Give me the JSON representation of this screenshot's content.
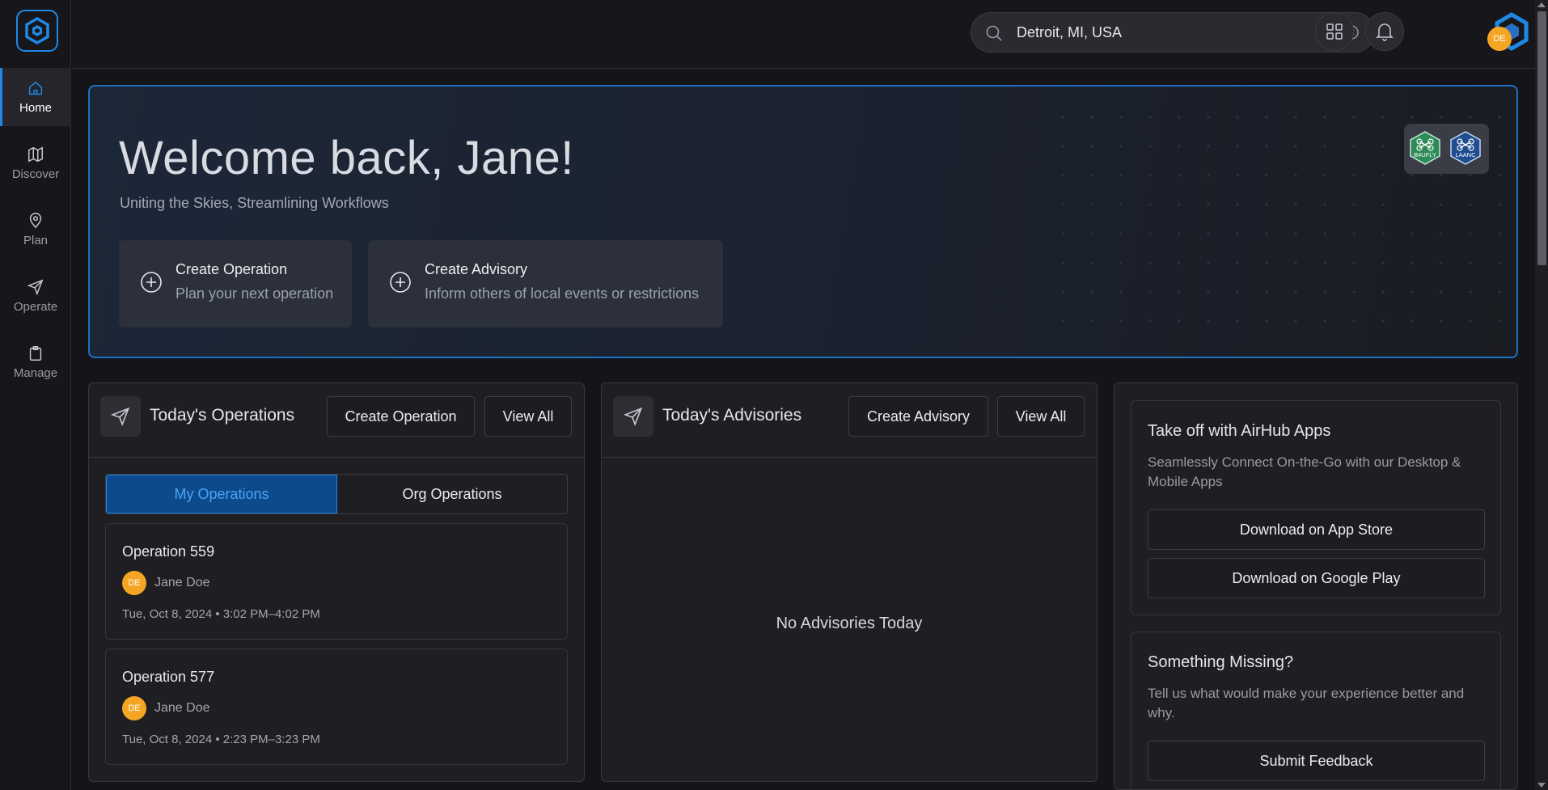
{
  "colors": {
    "accent": "#1e88e5",
    "avatar": "#f5a524",
    "background": "#151519"
  },
  "sidebar": {
    "items": [
      {
        "label": "Home",
        "icon": "home-icon",
        "active": true
      },
      {
        "label": "Discover",
        "icon": "map-icon"
      },
      {
        "label": "Plan",
        "icon": "map-pin-icon"
      },
      {
        "label": "Operate",
        "icon": "send-icon"
      },
      {
        "label": "Manage",
        "icon": "clipboard-icon"
      }
    ]
  },
  "header": {
    "search_value": "Detroit, MI, USA",
    "avatar_initials": "DE",
    "add_label": "+"
  },
  "hero": {
    "title": "Welcome back, Jane!",
    "subtitle": "Uniting the Skies, Streamlining Workflows",
    "cards": [
      {
        "title": "Create Operation",
        "subtitle": "Plan your next operation"
      },
      {
        "title": "Create Advisory",
        "subtitle": "Inform others of local events or restrictions"
      }
    ],
    "partners": [
      {
        "label": "B4UFLY",
        "color": "#2e8b57"
      },
      {
        "label": "LAANC",
        "color": "#1f4d8f"
      }
    ]
  },
  "operations": {
    "title": "Today's Operations",
    "create_label": "Create Operation",
    "view_all_label": "View All",
    "tabs": [
      "My Operations",
      "Org Operations"
    ],
    "items": [
      {
        "name": "Operation 559",
        "initials": "DE",
        "user": "Jane Doe",
        "time": "Tue, Oct 8, 2024 • 3:02 PM–4:02 PM"
      },
      {
        "name": "Operation 577",
        "initials": "DE",
        "user": "Jane Doe",
        "time": "Tue, Oct 8, 2024 • 2:23 PM–3:23 PM"
      }
    ]
  },
  "advisories": {
    "title": "Today's Advisories",
    "create_label": "Create Advisory",
    "view_all_label": "View All",
    "empty": "No Advisories Today"
  },
  "apps": {
    "title": "Take off with AirHub Apps",
    "description": "Seamlessly Connect On-the-Go with our Desktop & Mobile Apps",
    "app_store_label": "Download on App Store",
    "google_play_label": "Download on Google Play"
  },
  "feedback": {
    "title": "Something Missing?",
    "description": "Tell us what would make your experience better and why.",
    "button_label": "Submit Feedback"
  }
}
